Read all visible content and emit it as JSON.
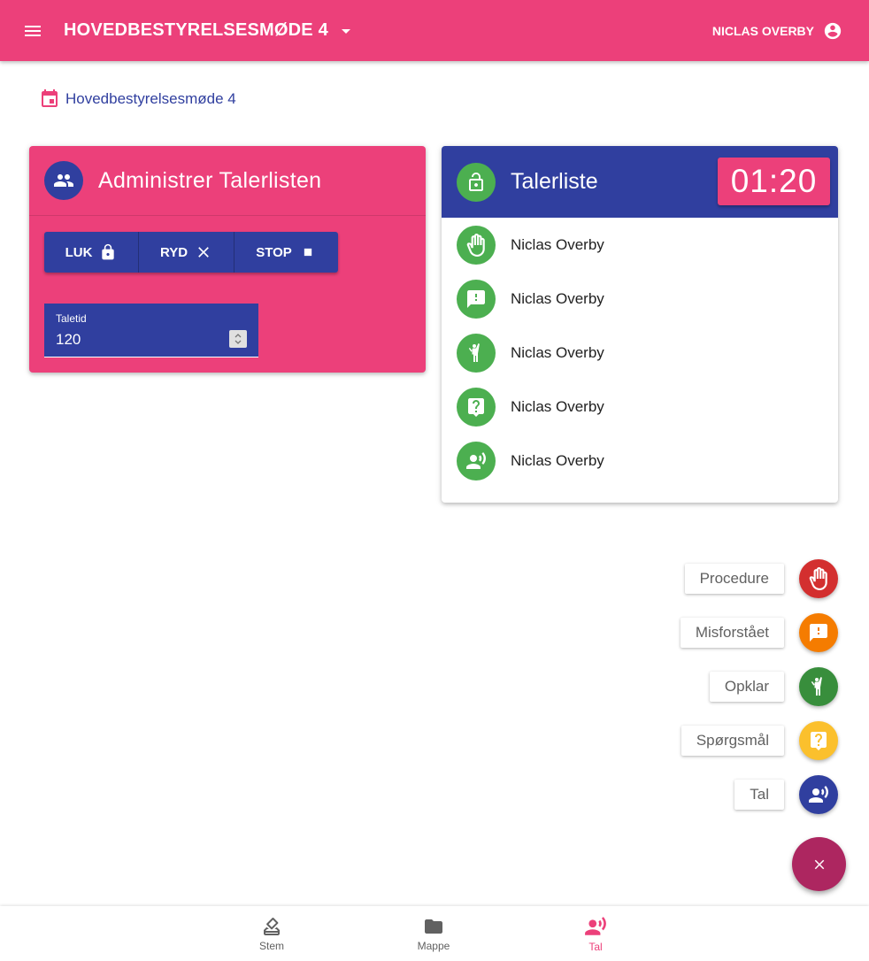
{
  "toolbar": {
    "menu_icon": "menu-icon",
    "title": "HOVEDBESTYRELSESMØDE 4",
    "user_name": "NICLAS OVERBY",
    "user_icon": "account-circle-icon",
    "color": "#ec407a"
  },
  "breadcrumb": {
    "label": "Hovedbestyrelsesmøde 4",
    "icon": "calendar-icon"
  },
  "admin": {
    "title": "Administrer Talerlisten",
    "buttons": {
      "close": "LUK",
      "clear": "RYD",
      "stop": "STOP"
    },
    "field": {
      "label": "Taletid",
      "value": "120"
    }
  },
  "speaker_list": {
    "title": "Talerliste",
    "timer": "01:20",
    "rows": [
      {
        "name": "Niclas Overby",
        "type": "procedure",
        "color": "#d32f2f"
      },
      {
        "name": "Niclas Overby",
        "type": "misunderstood",
        "color": "#f57c00"
      },
      {
        "name": "Niclas Overby",
        "type": "clarify",
        "color": "#388e3c"
      },
      {
        "name": "Niclas Overby",
        "type": "question",
        "color": "#fbc02d"
      },
      {
        "name": "Niclas Overby",
        "type": "speak",
        "color": "#303f9f"
      }
    ]
  },
  "speed_dial": {
    "procedure": "Procedure",
    "misunderstood": "Misforstået",
    "clarify": "Opklar",
    "question": "Spørgsmål",
    "speak": "Tal",
    "close_icon": "close-icon",
    "main_color": "#ad2660"
  },
  "bottom_nav": {
    "vote": "Stem",
    "folder": "Mappe",
    "speak": "Tal",
    "active": "speak"
  }
}
